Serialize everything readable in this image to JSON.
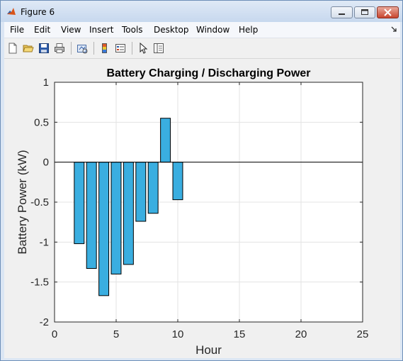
{
  "window": {
    "title": "Figure 6"
  },
  "menu": [
    "File",
    "Edit",
    "View",
    "Insert",
    "Tools",
    "Desktop",
    "Window",
    "Help"
  ],
  "toolbar_icons": [
    "new-figure-icon",
    "open-file-icon",
    "save-icon",
    "print-icon",
    "link-plot-icon",
    "insert-colorbar-icon",
    "insert-legend-icon",
    "pointer-icon",
    "property-editor-icon"
  ],
  "colors": {
    "bar_fill": "#3aaee0",
    "bar_edge": "#000000",
    "grid": "#e3e3e3",
    "axes_bg": "#ffffff"
  },
  "chart_data": {
    "type": "bar",
    "title": "Battery Charging / Discharging Power",
    "xlabel": "Hour",
    "ylabel": "Battery Power (kW)",
    "xlim": [
      0,
      25
    ],
    "ylim": [
      -2,
      1
    ],
    "xticks": [
      0,
      5,
      10,
      15,
      20,
      25
    ],
    "yticks": [
      1,
      0.5,
      0,
      -0.5,
      -1,
      -1.5,
      -2
    ],
    "grid": true,
    "x": [
      2,
      3,
      4,
      5,
      6,
      7,
      8,
      9,
      10
    ],
    "values": [
      -1.02,
      -1.33,
      -1.67,
      -1.4,
      -1.28,
      -0.74,
      -0.64,
      0.55,
      -0.47
    ]
  }
}
